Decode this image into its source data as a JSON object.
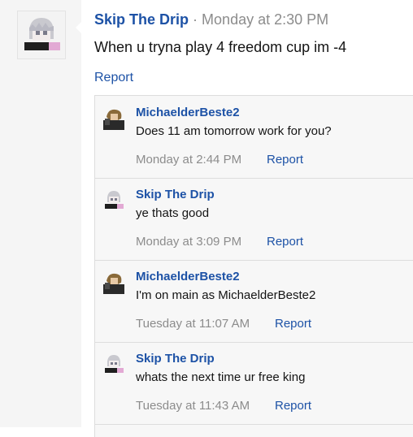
{
  "post": {
    "username": "Skip The Drip",
    "separator": "·",
    "timestamp": "Monday at 2:30 PM",
    "text": "When u tryna play 4 freedom cup im -4",
    "report_label": "Report",
    "avatar_icon": "anime-avatar-icon"
  },
  "replies": [
    {
      "username": "MichaelderBeste2",
      "text": "Does 11 am tomorrow work for you?",
      "timestamp": "Monday at 2:44 PM",
      "report_label": "Report",
      "avatar_icon": "character-avatar-icon"
    },
    {
      "username": "Skip The Drip",
      "text": "ye thats good",
      "timestamp": "Monday at 3:09 PM",
      "report_label": "Report",
      "avatar_icon": "anime-avatar-icon"
    },
    {
      "username": "MichaelderBeste2",
      "text": "I'm on main as MichaelderBeste2",
      "timestamp": "Tuesday at 11:07 AM",
      "report_label": "Report",
      "avatar_icon": "character-avatar-icon"
    },
    {
      "username": "Skip The Drip",
      "text": "whats the next time ur free king",
      "timestamp": "Tuesday at 11:43 AM",
      "report_label": "Report",
      "avatar_icon": "anime-avatar-icon"
    }
  ],
  "colors": {
    "link": "#1d52a6",
    "muted": "#8c8c8c",
    "reply_bg": "#f7f7f7",
    "strip_bg": "#f5f5f5"
  }
}
